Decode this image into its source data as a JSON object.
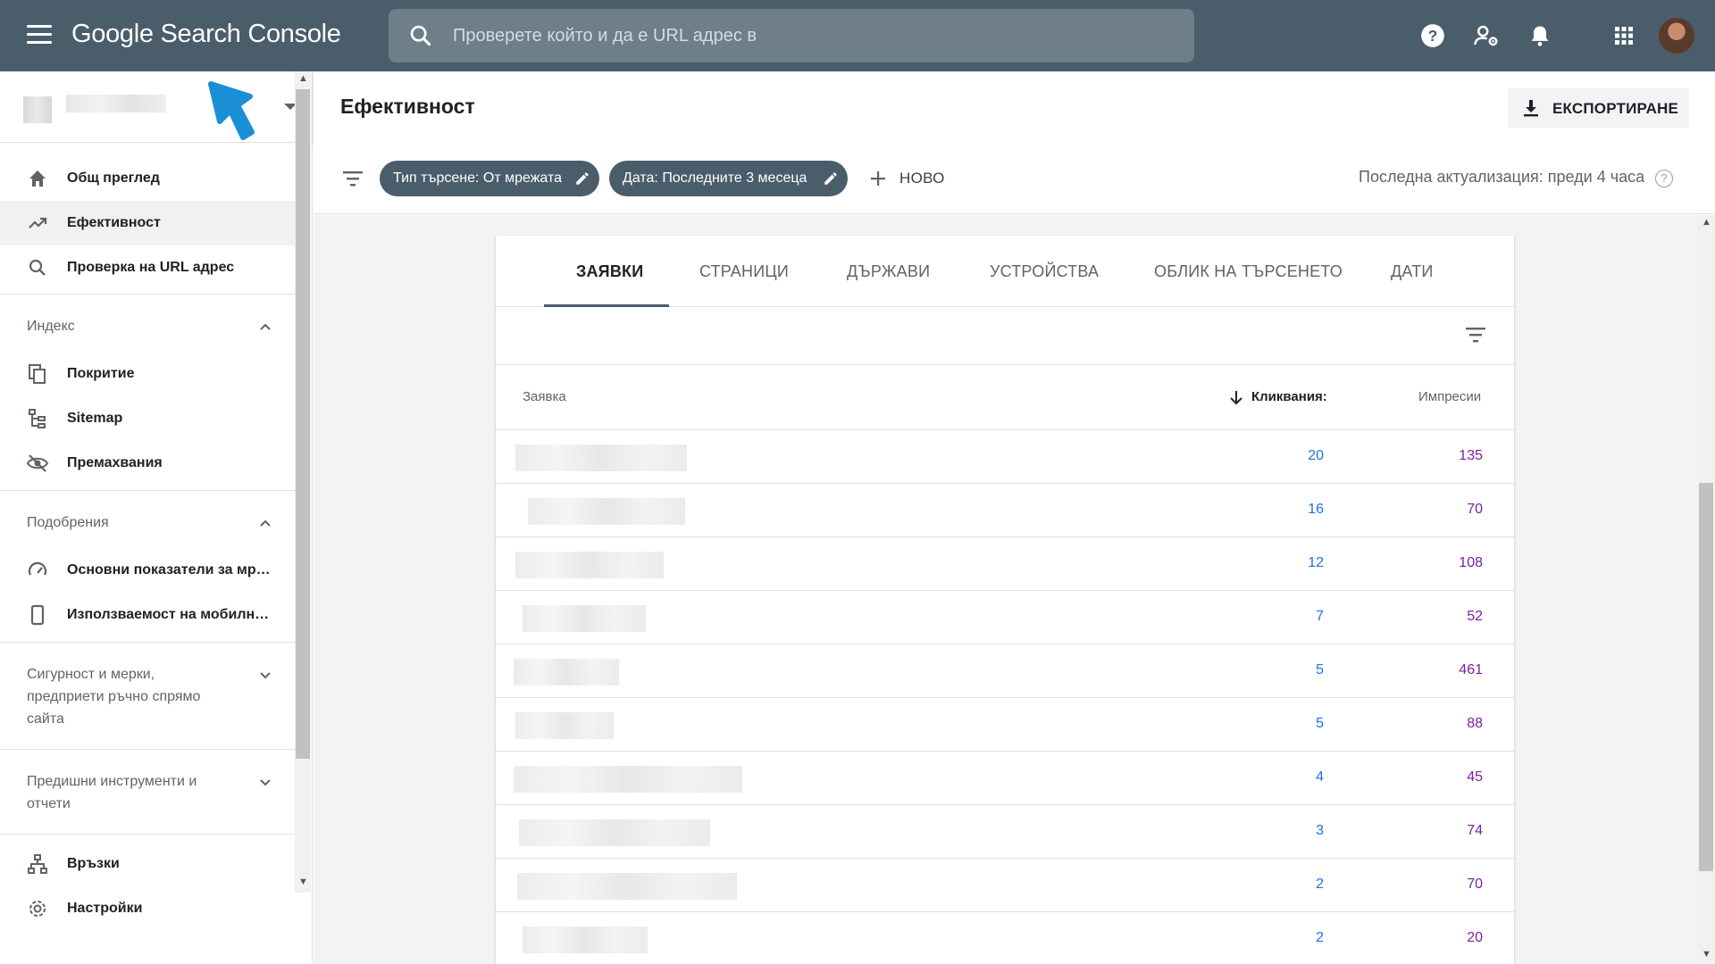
{
  "app": {
    "logo_text": "Google Search Console"
  },
  "search": {
    "placeholder": "Проверете който и да е URL адрес в"
  },
  "topbar_icons": [
    "menu-icon",
    "help-icon",
    "user-settings-icon",
    "bell-icon",
    "apps-grid-icon",
    "avatar"
  ],
  "sidebar": {
    "nav_top": [
      {
        "label": "Общ преглед",
        "icon": "home-icon"
      },
      {
        "label": "Ефективност",
        "icon": "trending-up-icon",
        "active": true
      },
      {
        "label": "Проверка на URL адрес",
        "icon": "search-icon"
      }
    ],
    "index_section": {
      "title": "Индекс",
      "items": [
        {
          "label": "Покритие",
          "icon": "coverage-icon"
        },
        {
          "label": "Sitemap",
          "icon": "sitemap-icon"
        },
        {
          "label": "Премахвания",
          "icon": "removals-icon"
        }
      ]
    },
    "enhancements_section": {
      "title": "Подобрения",
      "items": [
        {
          "label": "Основни показатели за мр…",
          "icon": "speed-icon"
        },
        {
          "label": "Използваемост на мобилн…",
          "icon": "mobile-icon"
        }
      ]
    },
    "security_section": {
      "title": "Сигурност и мерки, предприети ръчно спрямо сайта"
    },
    "legacy_section": {
      "title": "Предишни инструменти и отчети"
    },
    "bottom_items": [
      {
        "label": "Връзки",
        "icon": "links-icon"
      },
      {
        "label": "Настройки",
        "icon": "settings-icon"
      }
    ]
  },
  "header": {
    "title": "Ефективност",
    "export_label": "ЕКСПОРТИРАНЕ"
  },
  "filters": {
    "chip_search_type": "Тип търсене: От мрежата",
    "chip_date": "Дата: Последните 3 месеца",
    "new_label": "НОВО",
    "last_update": "Последна актуализация: преди 4 часа"
  },
  "tabs": [
    "ЗАЯВКИ",
    "СТРАНИЦИ",
    "ДЪРЖАВИ",
    "УСТРОЙСТВА",
    "ОБЛИК НА ТЪРСЕНЕТО",
    "ДАТИ"
  ],
  "table": {
    "col_query": "Заявка",
    "col_clicks": "Кликвания:",
    "col_impressions": "Импресии",
    "rows": [
      {
        "clicks": "20",
        "impressions": "135"
      },
      {
        "clicks": "16",
        "impressions": "70"
      },
      {
        "clicks": "12",
        "impressions": "108"
      },
      {
        "clicks": "7",
        "impressions": "52"
      },
      {
        "clicks": "5",
        "impressions": "461"
      },
      {
        "clicks": "5",
        "impressions": "88"
      },
      {
        "clicks": "4",
        "impressions": "45"
      },
      {
        "clicks": "3",
        "impressions": "74"
      },
      {
        "clicks": "2",
        "impressions": "70"
      },
      {
        "clicks": "2",
        "impressions": "20"
      }
    ]
  },
  "colors": {
    "topbar": "#4a5d6b",
    "clicks": "#1a73e8",
    "impressions": "#7b1fa2",
    "cursor": "#1a8fd6"
  }
}
